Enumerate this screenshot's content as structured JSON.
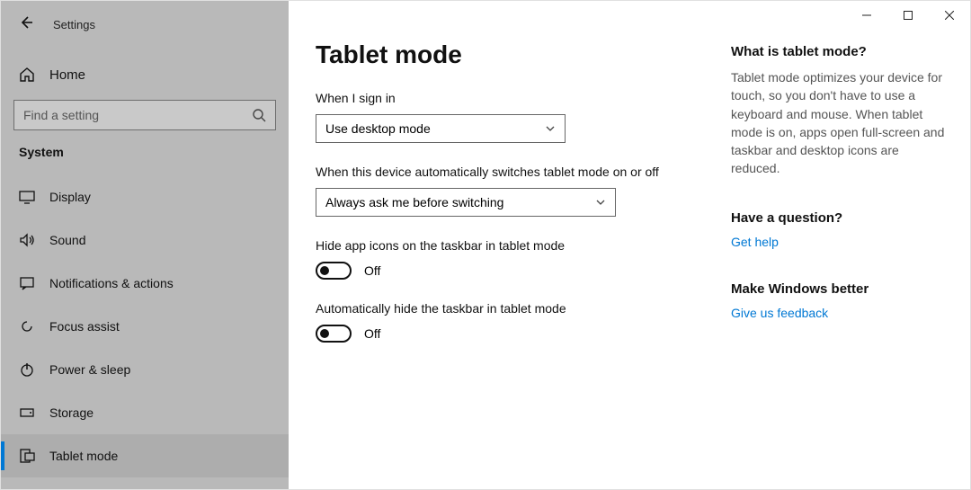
{
  "window": {
    "title": "Settings"
  },
  "sidebar": {
    "home": "Home",
    "search_placeholder": "Find a setting",
    "section": "System",
    "items": [
      {
        "label": "Display"
      },
      {
        "label": "Sound"
      },
      {
        "label": "Notifications & actions"
      },
      {
        "label": "Focus assist"
      },
      {
        "label": "Power & sleep"
      },
      {
        "label": "Storage"
      },
      {
        "label": "Tablet mode"
      }
    ]
  },
  "page": {
    "heading": "Tablet mode",
    "signin_label": "When I sign in",
    "signin_value": "Use desktop mode",
    "auto_label": "When this device automatically switches tablet mode on or off",
    "auto_value": "Always ask me before switching",
    "hide_icons_label": "Hide app icons on the taskbar in tablet mode",
    "hide_icons_state": "Off",
    "hide_taskbar_label": "Automatically hide the taskbar in tablet mode",
    "hide_taskbar_state": "Off"
  },
  "aside": {
    "info_title": "What is tablet mode?",
    "info_body": "Tablet mode optimizes your device for touch, so you don't have to use a keyboard and mouse. When tablet mode is on, apps open full-screen and taskbar and desktop icons are reduced.",
    "question_title": "Have a question?",
    "question_link": "Get help",
    "feedback_title": "Make Windows better",
    "feedback_link": "Give us feedback"
  }
}
